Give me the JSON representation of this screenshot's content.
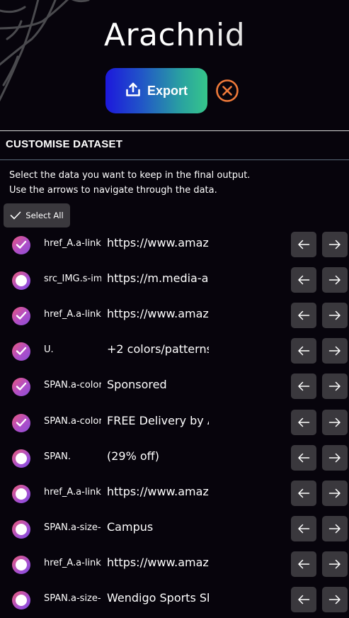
{
  "app": {
    "title": "Arachnid"
  },
  "toolbar": {
    "export_label": "Export"
  },
  "section": {
    "title": "CUSTOMISE DATASET"
  },
  "instructions": {
    "line1": "Select the data you want to keep in the final output.",
    "line2": "Use the arrows to navigate through the data."
  },
  "select_all": {
    "label": "Select All"
  },
  "rows": [
    {
      "key": "href_A.a-link-normal",
      "value": "https://www.amazon.com",
      "checked": true
    },
    {
      "key": "src_IMG.s-image",
      "value": "https://m.media-amazon.com",
      "checked": false
    },
    {
      "key": "href_A.a-link-normal",
      "value": "https://www.amazon.com",
      "checked": true
    },
    {
      "key": "U.",
      "value": "+2 colors/patterns",
      "checked": true
    },
    {
      "key": "SPAN.a-color-secondary",
      "value": "Sponsored",
      "checked": true
    },
    {
      "key": "SPAN.a-color-base",
      "value": "FREE Delivery by Amazon",
      "checked": true
    },
    {
      "key": "SPAN.",
      "value": "(29% off)",
      "checked": false
    },
    {
      "key": "href_A.a-link-normal",
      "value": "https://www.amazon.com",
      "checked": false
    },
    {
      "key": "SPAN.a-size-base",
      "value": "Campus",
      "checked": false
    },
    {
      "key": "href_A.a-link-normal",
      "value": "https://www.amazon.com",
      "checked": false
    },
    {
      "key": "SPAN.a-size-base",
      "value": "Wendigo Sports Shoes",
      "checked": false
    }
  ],
  "colors": {
    "background": "#07040c",
    "export_gradient_start": "#1c18dc",
    "export_gradient_end": "#36c68a",
    "close_accent": "#f07a3a",
    "check_accent": "#b04ec7",
    "nav_button": "#3a383d"
  },
  "icons": {
    "export": "upload-icon",
    "close": "close-circle-icon",
    "select_all": "checkmark-icon",
    "prev": "arrow-left-icon",
    "next": "arrow-right-icon",
    "decoration": "spider-web-icon"
  }
}
